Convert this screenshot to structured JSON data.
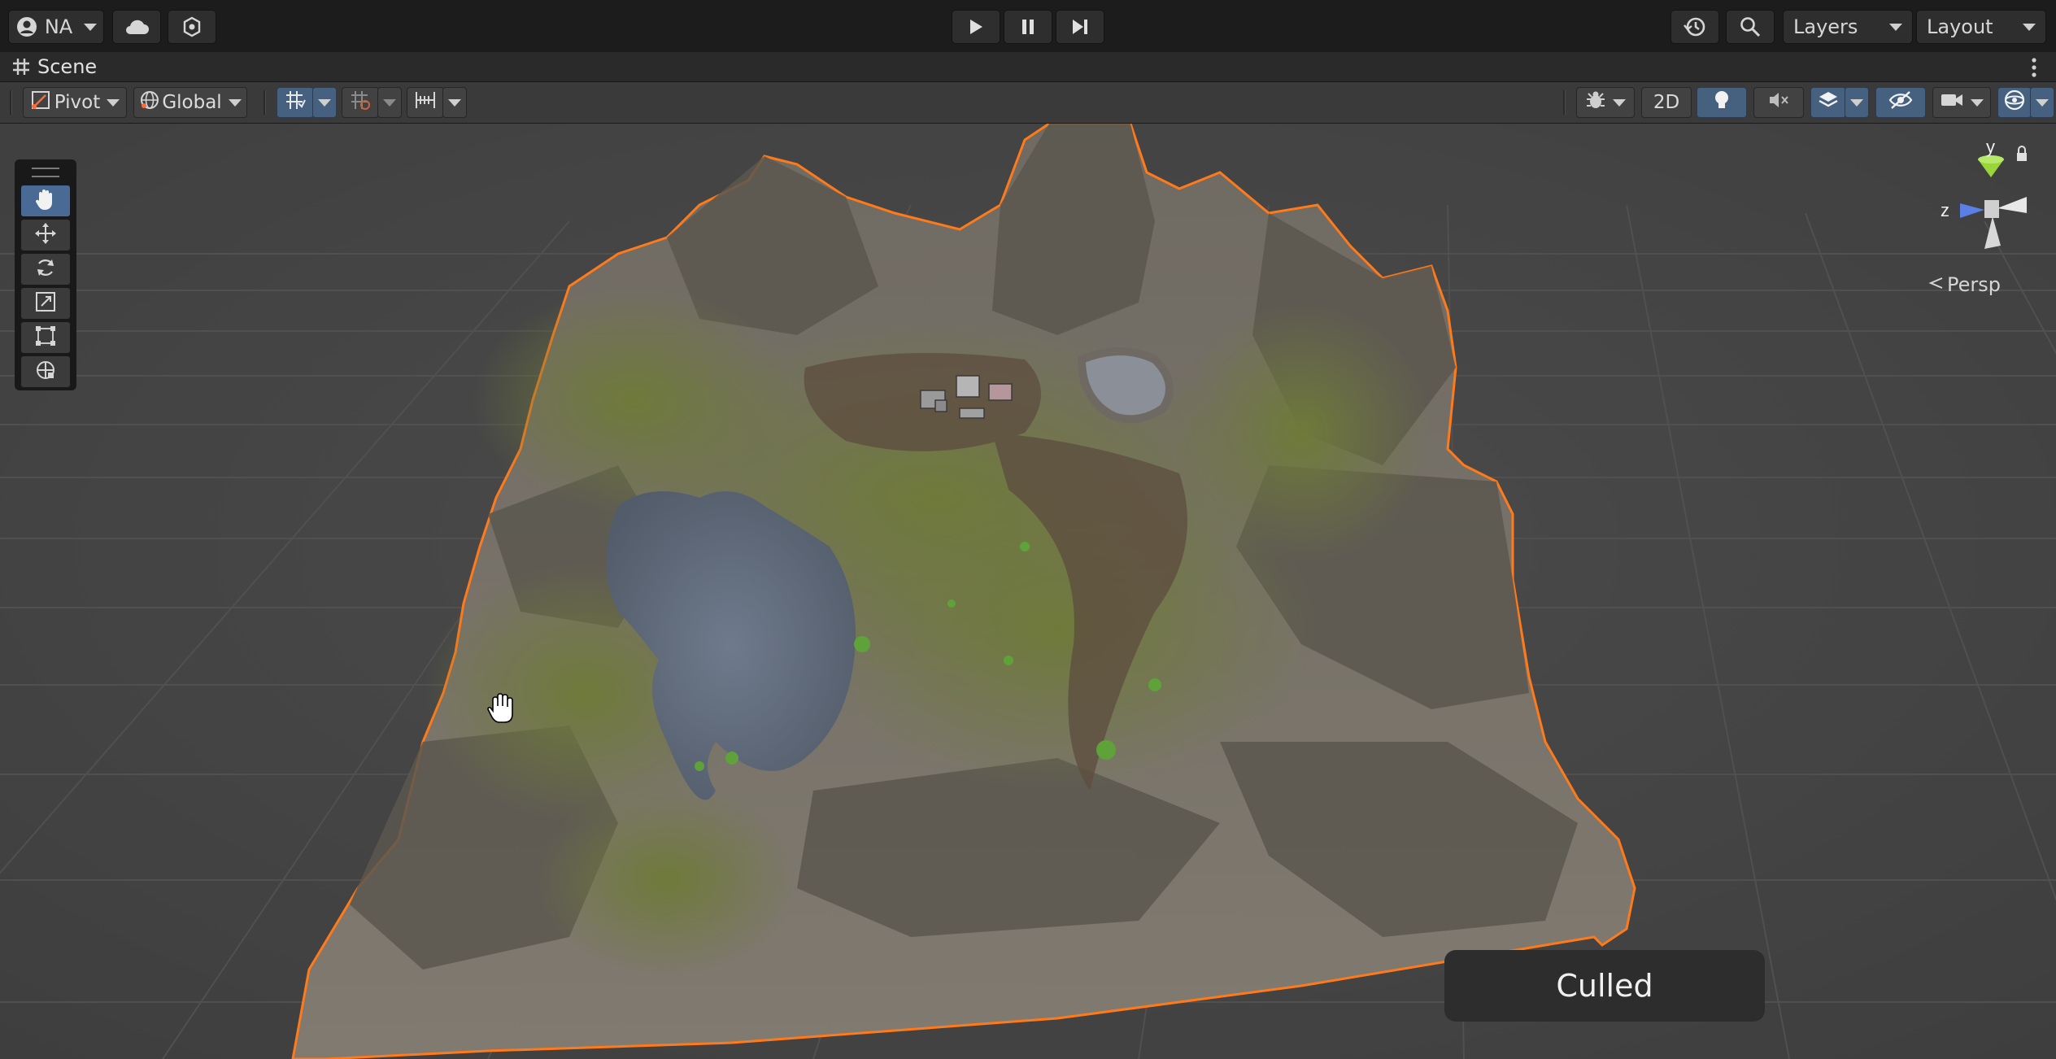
{
  "topbar": {
    "account_label": "NA",
    "layers_label": "Layers",
    "layout_label": "Layout",
    "icons": [
      "account-icon",
      "cloud-icon",
      "services-icon",
      "play-icon",
      "pause-icon",
      "step-icon",
      "history-icon",
      "search-icon"
    ]
  },
  "tab": {
    "title": "Scene"
  },
  "scene_toolbar": {
    "pivot_label": "Pivot",
    "global_label": "Global",
    "mode_2d_label": "2D"
  },
  "viewport": {
    "projection_label": "Persp",
    "gizmo_axes": {
      "y": "y",
      "z": "z"
    },
    "status_label": "Culled"
  },
  "colors": {
    "accent_active": "#4a6a96",
    "selection_outline": "#ff7a1a",
    "gizmo_y": "#9ad63a",
    "gizmo_z": "#5a7fe6"
  }
}
